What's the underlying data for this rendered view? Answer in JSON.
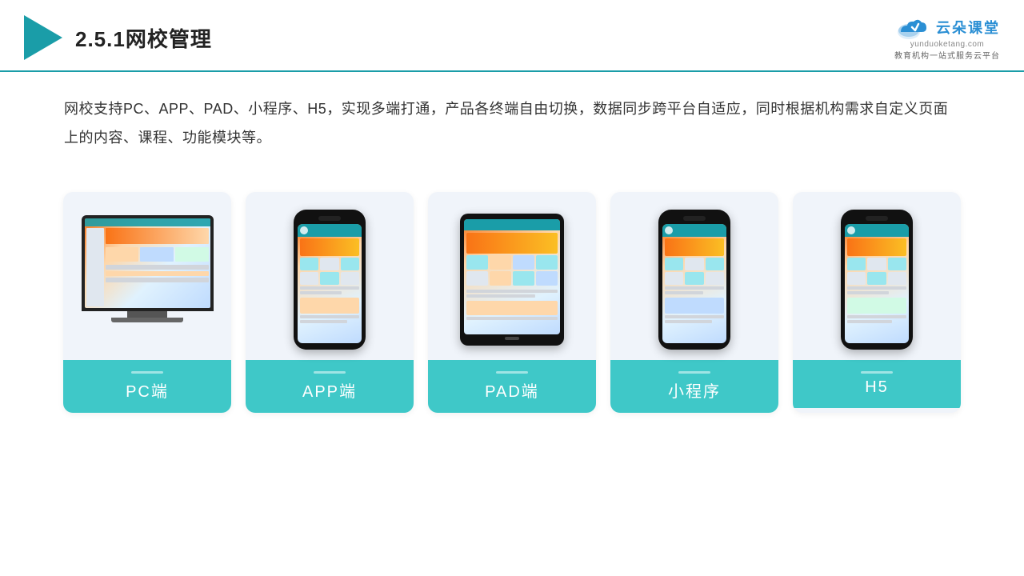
{
  "header": {
    "title": "2.5.1网校管理",
    "brand": {
      "name": "云朵课堂",
      "domain": "yunduoketang.com",
      "tagline": "教育机构一站\n式服务云平台"
    }
  },
  "description": {
    "text": "网校支持PC、APP、PAD、小程序、H5，实现多端打通，产品各终端自由切换，数据同步跨平台自适应，同时根据机构需求自定义页面上的内容、课程、功能模块等。"
  },
  "cards": [
    {
      "id": "pc",
      "label": "PC端"
    },
    {
      "id": "app",
      "label": "APP端"
    },
    {
      "id": "pad",
      "label": "PAD端"
    },
    {
      "id": "miniprogram",
      "label": "小程序"
    },
    {
      "id": "h5",
      "label": "H5"
    }
  ]
}
